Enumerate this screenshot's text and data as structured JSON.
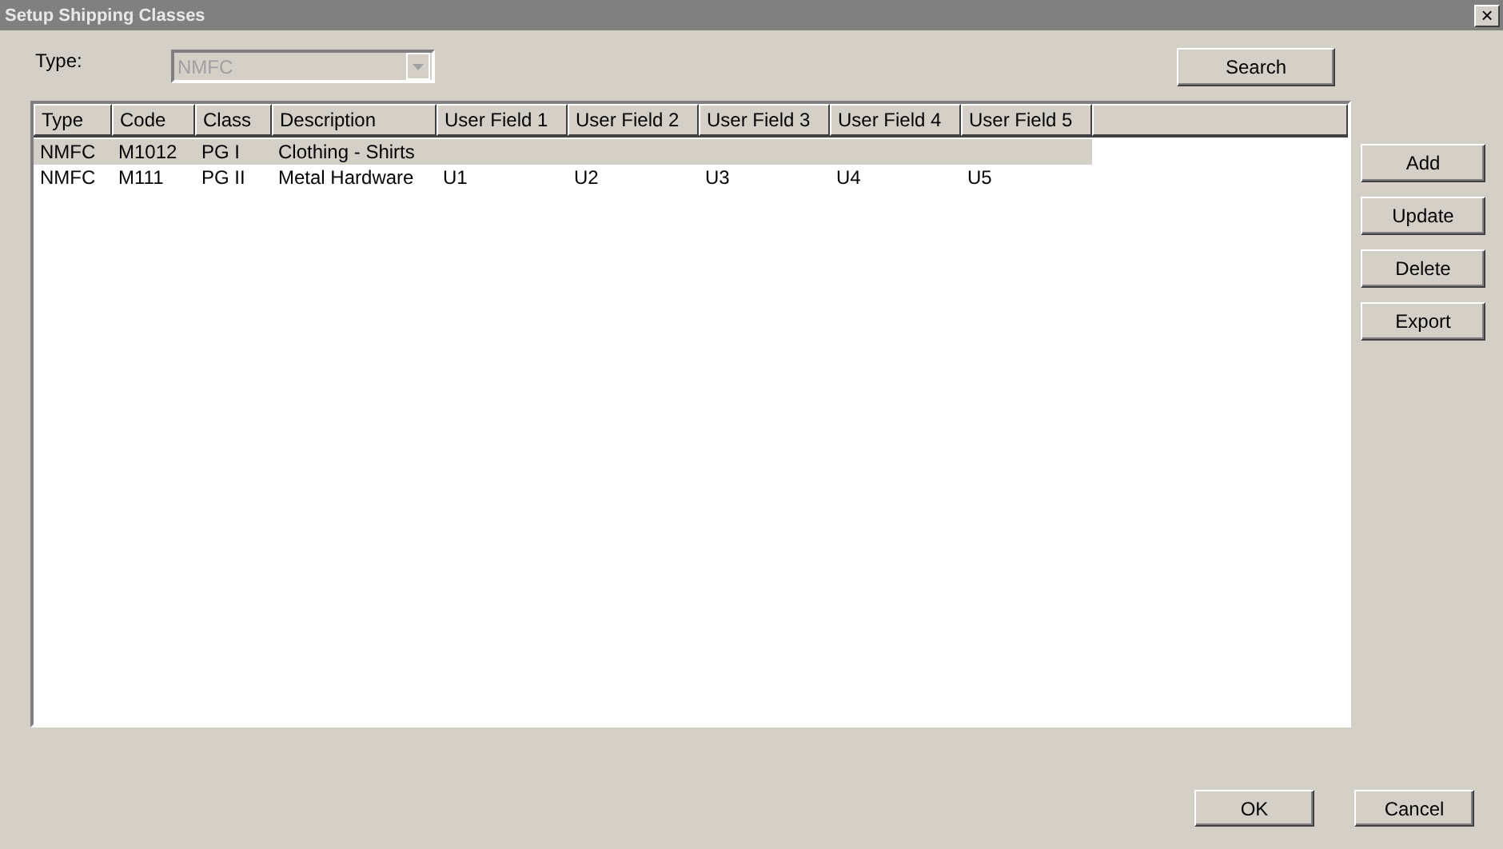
{
  "window": {
    "title": "Setup Shipping Classes",
    "close": "×"
  },
  "type_field": {
    "label": "Type:",
    "value": "NMFC",
    "disabled": true
  },
  "search_button": "Search",
  "table": {
    "columns": [
      "Type",
      "Code",
      "Class",
      "Description",
      "User Field 1",
      "User Field 2",
      "User Field 3",
      "User Field 4",
      "User Field 5"
    ],
    "rows": [
      {
        "selected": true,
        "cells": [
          "NMFC",
          "M1012",
          "PG I",
          "Clothing - Shirts",
          "",
          "",
          "",
          "",
          ""
        ]
      },
      {
        "selected": false,
        "cells": [
          "NMFC",
          "M111",
          "PG II",
          "Metal Hardware",
          "U1",
          "U2",
          "U3",
          "U4",
          "U5"
        ]
      }
    ]
  },
  "side_buttons": [
    "Add",
    "Update",
    "Delete",
    "Export"
  ],
  "footer_buttons": [
    "OK",
    "Cancel"
  ]
}
